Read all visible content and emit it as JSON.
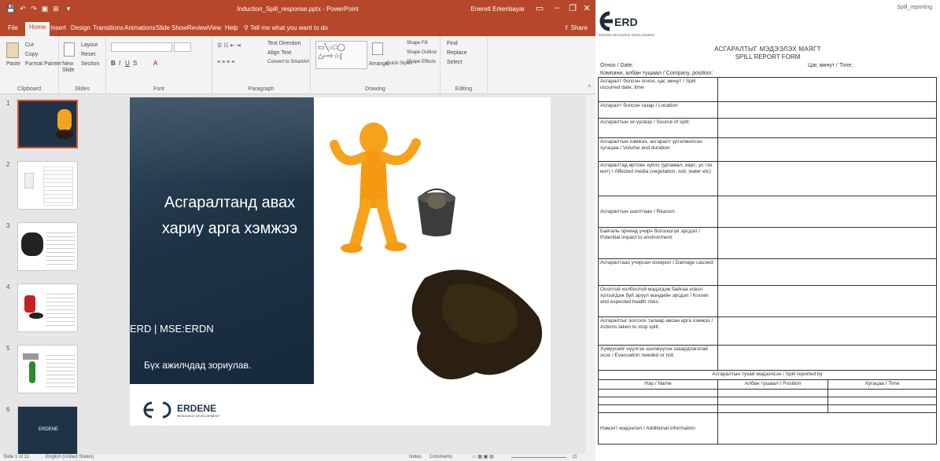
{
  "window": {
    "title": "Induction_Spill_response.pptx - PowerPoint",
    "user": "Enerelt Erkenbayar",
    "qat": [
      "💾",
      "↶",
      "↷",
      "▣",
      "⊞",
      "▾"
    ]
  },
  "tabs": [
    "File",
    "Home",
    "Insert",
    "Design",
    "Transitions",
    "Animations",
    "Slide Show",
    "Review",
    "View",
    "Help"
  ],
  "tell_me": "Tell me what you want to do",
  "share": "Share",
  "ribbon": {
    "clipboard": {
      "label": "Clipboard",
      "paste": "Paste",
      "cut": "Cut",
      "copy": "Copy",
      "painter": "Format Painter"
    },
    "slides": {
      "label": "Slides",
      "new": "New Slide",
      "layout": "Layout",
      "reset": "Reset",
      "section": "Section"
    },
    "font": {
      "label": "Font"
    },
    "paragraph": {
      "label": "Paragraph",
      "direction": "Text Direction",
      "align": "Align Text",
      "smartart": "Convert to SmartArt"
    },
    "drawing": {
      "label": "Drawing",
      "arrange": "Arrange",
      "quick": "Quick Styles",
      "fill": "Shape Fill",
      "outline": "Shape Outline",
      "effects": "Shape Effects"
    },
    "editing": {
      "label": "Editing",
      "find": "Find",
      "replace": "Replace",
      "select": "Select"
    }
  },
  "thumbnails": [
    "1",
    "2",
    "3",
    "4",
    "5",
    "6"
  ],
  "slide": {
    "title": "Асгаралтанд авах хариу арга хэмжээ",
    "brand": "ERD | MSE:ERDN",
    "subtitle": "Бүх ажилчдад зориулав.",
    "logo": "ERDENE",
    "logo_tag": "RESOURCE DEVELOPMENT"
  },
  "status": {
    "slide": "Slide 1 of 11",
    "lang": "English (United States)",
    "notes": "Notes",
    "comments": "Comments"
  },
  "form": {
    "header_right": "Spill_reporting",
    "logo": "ERD",
    "logo_tag": "ERDENE RESOURCE DEVELOPMENT",
    "title_mn": "АСГАРАЛТЫГ МЭДЭЭЛЭХ МАЯГТ",
    "title_en": "SPILL REPORT FORM",
    "date_label": "Огноо / Date:",
    "time_label": "Цаг, минут / Time:",
    "company_label": "Компани, албан тушаал / Company, position:",
    "rows": [
      "Асгаралт болсон огноо, цаг, минут / Spill occurred date, time",
      "Асгаралт болсон газар / Location:",
      "Асгаралтын эх үүсвэр / Source of spill:",
      "Асгаралтын хэмжээ, асгаралт үргэлжилсэн хугацаа / Volume and duration:",
      "Асгаралтад өртсөн зүйлс (ургамал, хөрс, ус гэх мэт) / Affected media (vegetation, soil, water etc)",
      "Асгаралтын шалтгаан / Reason:",
      "Байгаль орчинд учирч болзошгүй эрсдэл / Potential impact to environment:",
      "Асгаралтаас учирсан хохирол / Damage caused:",
      "Осолтой холбоотой мэдэгдэж байгаа эсвэл хүлээгдэж буй эрүүл мэндийн эрсдэл / Known and expected health risks:",
      "Асгаралтыг зогсоох талаар авсан арга хэмжээ / Actions taken to stop spill:",
      "Хүмүүсийг нүүлгэн шилжүүлэх шаардлагатай эсэх / Evacuation needed or not:"
    ],
    "reported_by": "Асгаралтын тухай мэдээлсэн / Spill reported by",
    "col_name": "Нэр / Name",
    "col_position": "Албан тушаал / Position",
    "col_time": "Хугацаа / Time",
    "additional": "Нэмэлт мэдээлэл / Additional information"
  }
}
